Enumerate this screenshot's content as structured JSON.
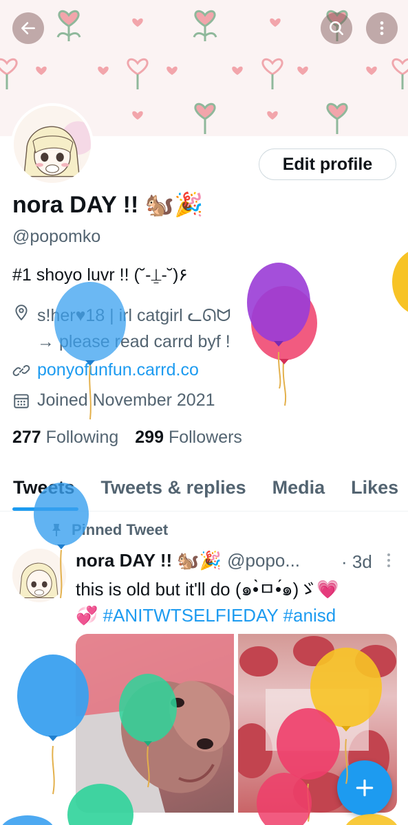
{
  "header": {
    "back_icon": "back-arrow-icon",
    "search_icon": "search-icon",
    "more_icon": "more-vertical-icon"
  },
  "profile": {
    "edit_label": "Edit profile",
    "display_name": "nora DAY !! 🐿️🎉",
    "handle": "@popomko",
    "bio": "#1 shoyo luvr !! (˘-⍊-˘)۶",
    "location_line1": "s!her♥18 | irl catgirl ᓚᘏᗢ",
    "location_line2": "→ please read carrd byf !",
    "website": "ponyofunfun.carrd.co",
    "joined": "Joined November 2021",
    "following_count": "277",
    "following_label": "Following",
    "followers_count": "299",
    "followers_label": "Followers"
  },
  "tabs": [
    {
      "label": "Tweets"
    },
    {
      "label": "Tweets & replies"
    },
    {
      "label": "Media"
    },
    {
      "label": "Likes"
    }
  ],
  "tweet": {
    "pinned_label": "Pinned Tweet",
    "name": "nora DAY !! 🐿️🎉",
    "handle": "@popo...",
    "time": "· 3d",
    "text_line1": "this is old but it'll do (๑•̀ㅁ•́๑)ゞ💗",
    "text_line2_emoji": "💞",
    "hashtags": "#ANITWTSELFIEDAY #anisd"
  },
  "colors": {
    "accent": "#1d9bf0",
    "text": "#0f1419",
    "muted": "#536471"
  }
}
